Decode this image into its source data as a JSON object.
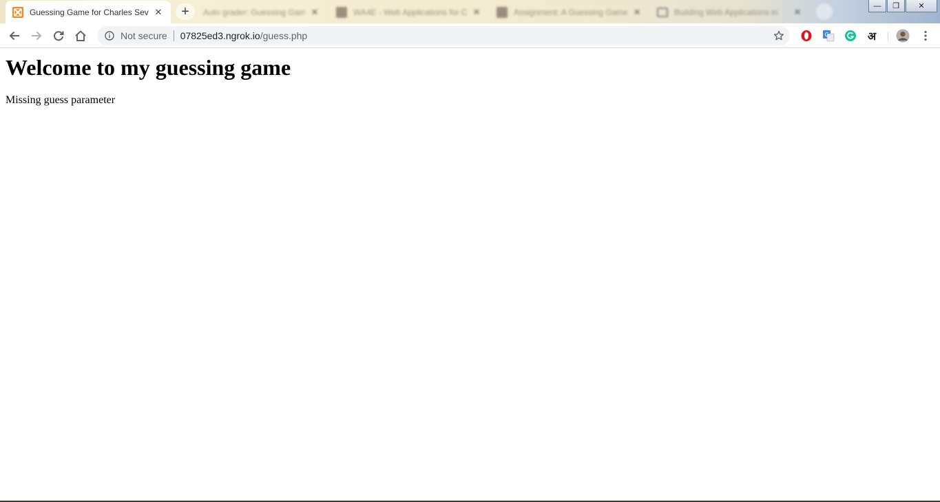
{
  "browser": {
    "tabs": [
      {
        "title": "Guessing Game for Charles Sever",
        "favicon": "xampp-icon",
        "active": true
      },
      {
        "title": "Auto grader: Guessing Game",
        "favicon": "blurred",
        "active": false
      },
      {
        "title": "WA4E - Web Applications for C",
        "favicon": "gray-square",
        "active": false
      },
      {
        "title": "Assignment: A Guessing Game",
        "favicon": "gray-square",
        "active": false
      },
      {
        "title": "Building Web Applications in",
        "favicon": "camera-icon",
        "active": false
      }
    ],
    "tab_close_glyph": "✕",
    "new_tab_glyph": "+",
    "window_controls": {
      "minimize": "—",
      "restore": "❐",
      "close": "✕"
    }
  },
  "toolbar": {
    "security_label": "Not secure",
    "url_host": "07825ed3.ngrok.io",
    "url_path": "/guess.php",
    "ext_hindi_label": "अ"
  },
  "page": {
    "heading": "Welcome to my guessing game",
    "message": "Missing guess parameter"
  },
  "colors": {
    "xampp_orange": "#f08a24",
    "opera_red": "#e0141e",
    "grammarly_green": "#15c39a",
    "translate_blue": "#4285f4"
  }
}
